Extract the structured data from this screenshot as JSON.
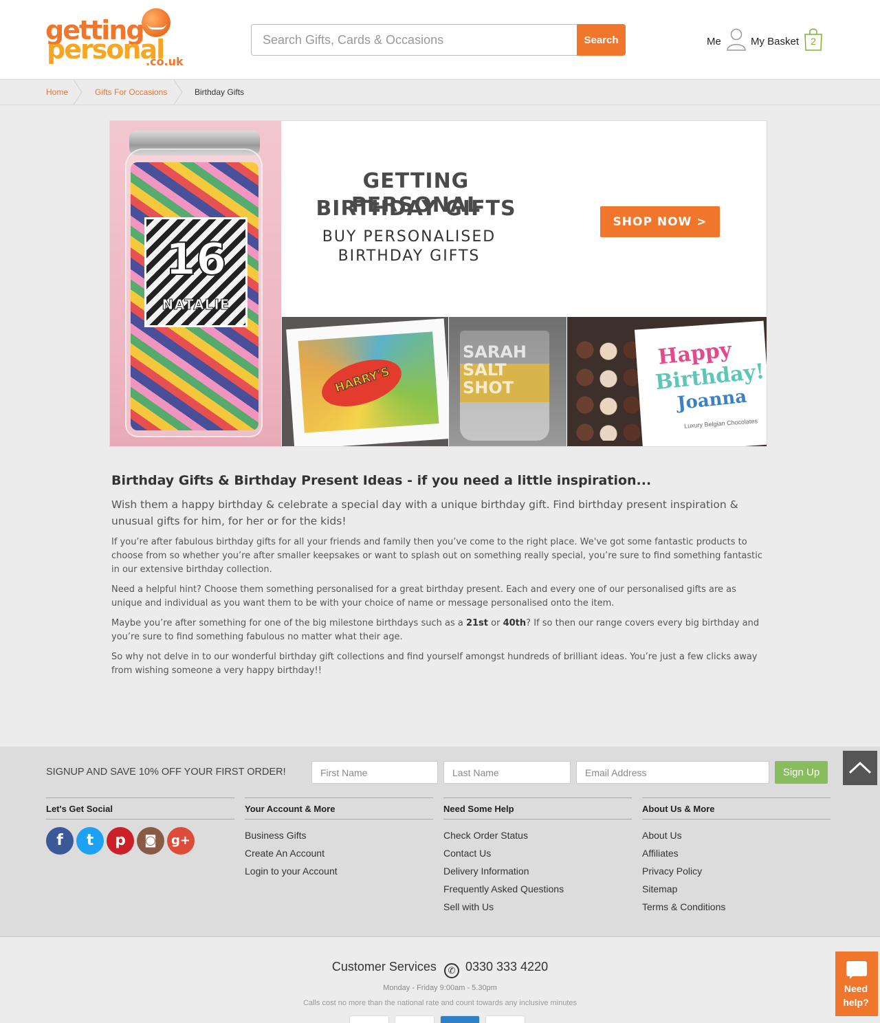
{
  "header": {
    "logo": {
      "line1": "getting",
      "line2": "personal",
      "line3": ".co.uk"
    },
    "search": {
      "placeholder": "Search Gifts, Cards & Occasions",
      "button": "Search"
    },
    "me_label": "Me",
    "basket_label": "My Basket",
    "basket_count": "2"
  },
  "breadcrumb": {
    "home": "Home",
    "occasions": "Gifts For Occasions",
    "current": "Birthday Gifts"
  },
  "banner": {
    "title1": "GETTING PERSONAL",
    "title2": "BIRTHDAY GIFTS",
    "sub1": "BUY PERSONALISED",
    "sub2": "BIRTHDAY GIFTS",
    "cta": "SHOP NOW >",
    "jar_number": "16",
    "jar_name": "NATALIE",
    "sign_text": "HARRY'S",
    "glass_text": "SARAH SALT SHOT",
    "card_line1": "Happy",
    "card_line2": "Birthday!",
    "card_line3": "Joanna",
    "card_small": "Luxury Belgian Chocolates"
  },
  "content": {
    "heading": "Birthday Gifts & Birthday Present Ideas - if you need a little inspiration...",
    "lead": "Wish them a happy birthday & celebrate a special day with a unique birthday gift. Find birthday present inspiration & unusual gifts for him, for her or for the kids!",
    "p1": "If you’re after fabulous birthday gifts for all your friends and family then you’ve come to the right place. We've got some fantastic products to choose from so whether you’re after smaller keepsakes or want to splash out on something really special, you’re sure to find something fantastic in our extensive birthday collection.",
    "p2": "Need a helpful hint? Choose them something personalised for a great birthday present. Each and every one of our personalised gifts are as unique and individual as you want them to be with your choice of name or message personalised onto the item.",
    "p3_a": "Maybe you’re after something for one of the big milestone birthdays such as a ",
    "p3_b1": "21st",
    "p3_or": " or ",
    "p3_b2": "40th",
    "p3_c": "? If so then our range covers every big birthday and you’re sure to find something fabulous no matter what their age.",
    "p4": "So why not delve in to our wonderful birthday gift collections and find yourself amongst hundreds of brilliant ideas. You’re just a few clicks away from wishing someone a very happy birthday!!"
  },
  "signup": {
    "label": "SIGNUP AND SAVE 10% OFF YOUR FIRST ORDER!",
    "first_name": "First Name",
    "last_name": "Last Name",
    "email": "Email Address",
    "button": "Sign Up"
  },
  "footer": {
    "social": {
      "title": "Let's Get Social",
      "icons": [
        "f",
        "t",
        "p",
        "◙",
        "g+"
      ]
    },
    "account": {
      "title": "Your Account & More",
      "links": [
        "Business Gifts",
        "Create An Account",
        "Login to your Account"
      ]
    },
    "help": {
      "title": "Need Some Help",
      "links": [
        "Check Order Status",
        "Contact Us",
        "Delivery Information",
        "Frequently Asked Questions",
        "Sell with Us"
      ]
    },
    "about": {
      "title": "About Us & More",
      "links": [
        "About Us",
        "Affiliates",
        "Privacy Policy",
        "Sitemap",
        "Terms & Conditions"
      ]
    },
    "customer_services": "Customer Services",
    "phone": "0330 333 4220",
    "hours": "Monday - Friday 9:00am - 5.30pm",
    "calls_note": "Calls cost no more than the national rate and count towards any inclusive minutes"
  },
  "help_widget": {
    "line1": "Need",
    "line2": "help?"
  },
  "colors": {
    "accent": "#f0762b",
    "signup_green": "#88bd5d",
    "facebook": "#3b5998",
    "twitter": "#1da1f2",
    "pinterest": "#cb2027",
    "instagram": "#8a5a44",
    "google": "#dd4b39"
  }
}
